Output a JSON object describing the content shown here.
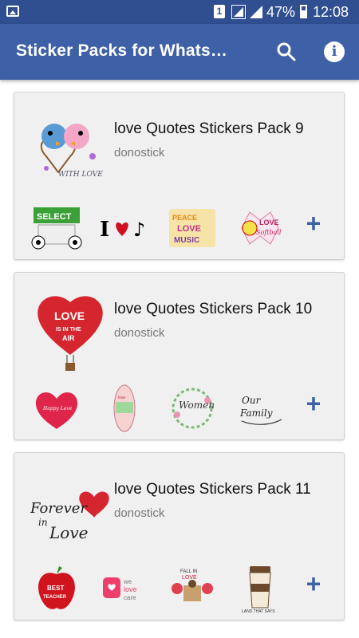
{
  "status_bar": {
    "sim_label": "1",
    "battery_text": "47%",
    "time": "12:08"
  },
  "app_bar": {
    "title": "Sticker Packs for Whats…"
  },
  "icons": {
    "search": "search-icon",
    "info": "info-icon",
    "add": "plus-icon"
  },
  "colors": {
    "app_bar": "#3d60a6",
    "status_bar": "#2f4f91",
    "accent": "#3d60a6"
  },
  "packs": [
    {
      "name": "love Quotes Stickers Pack 9",
      "author": "donostick",
      "tray_text": "WITH LOVE",
      "stickers": [
        {
          "text": "SELECT"
        },
        {
          "text": "I"
        },
        {
          "text": "PEACE LOVE MUSIC"
        },
        {
          "text": "LOVE Softball"
        }
      ],
      "add_label": "+"
    },
    {
      "name": "love Quotes Stickers Pack 10",
      "author": "donostick",
      "tray_text": "LOVE IS IN THE AIR",
      "stickers": [
        {
          "text": "Happy Love"
        },
        {
          "text": ""
        },
        {
          "text": "Women"
        },
        {
          "text": "Our Family"
        }
      ],
      "add_label": "+"
    },
    {
      "name": "love Quotes Stickers Pack 11",
      "author": "donostick",
      "tray_text": "Forever in Love",
      "stickers": [
        {
          "text": "BEST TEACHER"
        },
        {
          "text": "we love care"
        },
        {
          "text": "FALL IN LOVE"
        },
        {
          "text": "LAND THAT SAYS"
        }
      ],
      "add_label": "+"
    }
  ]
}
